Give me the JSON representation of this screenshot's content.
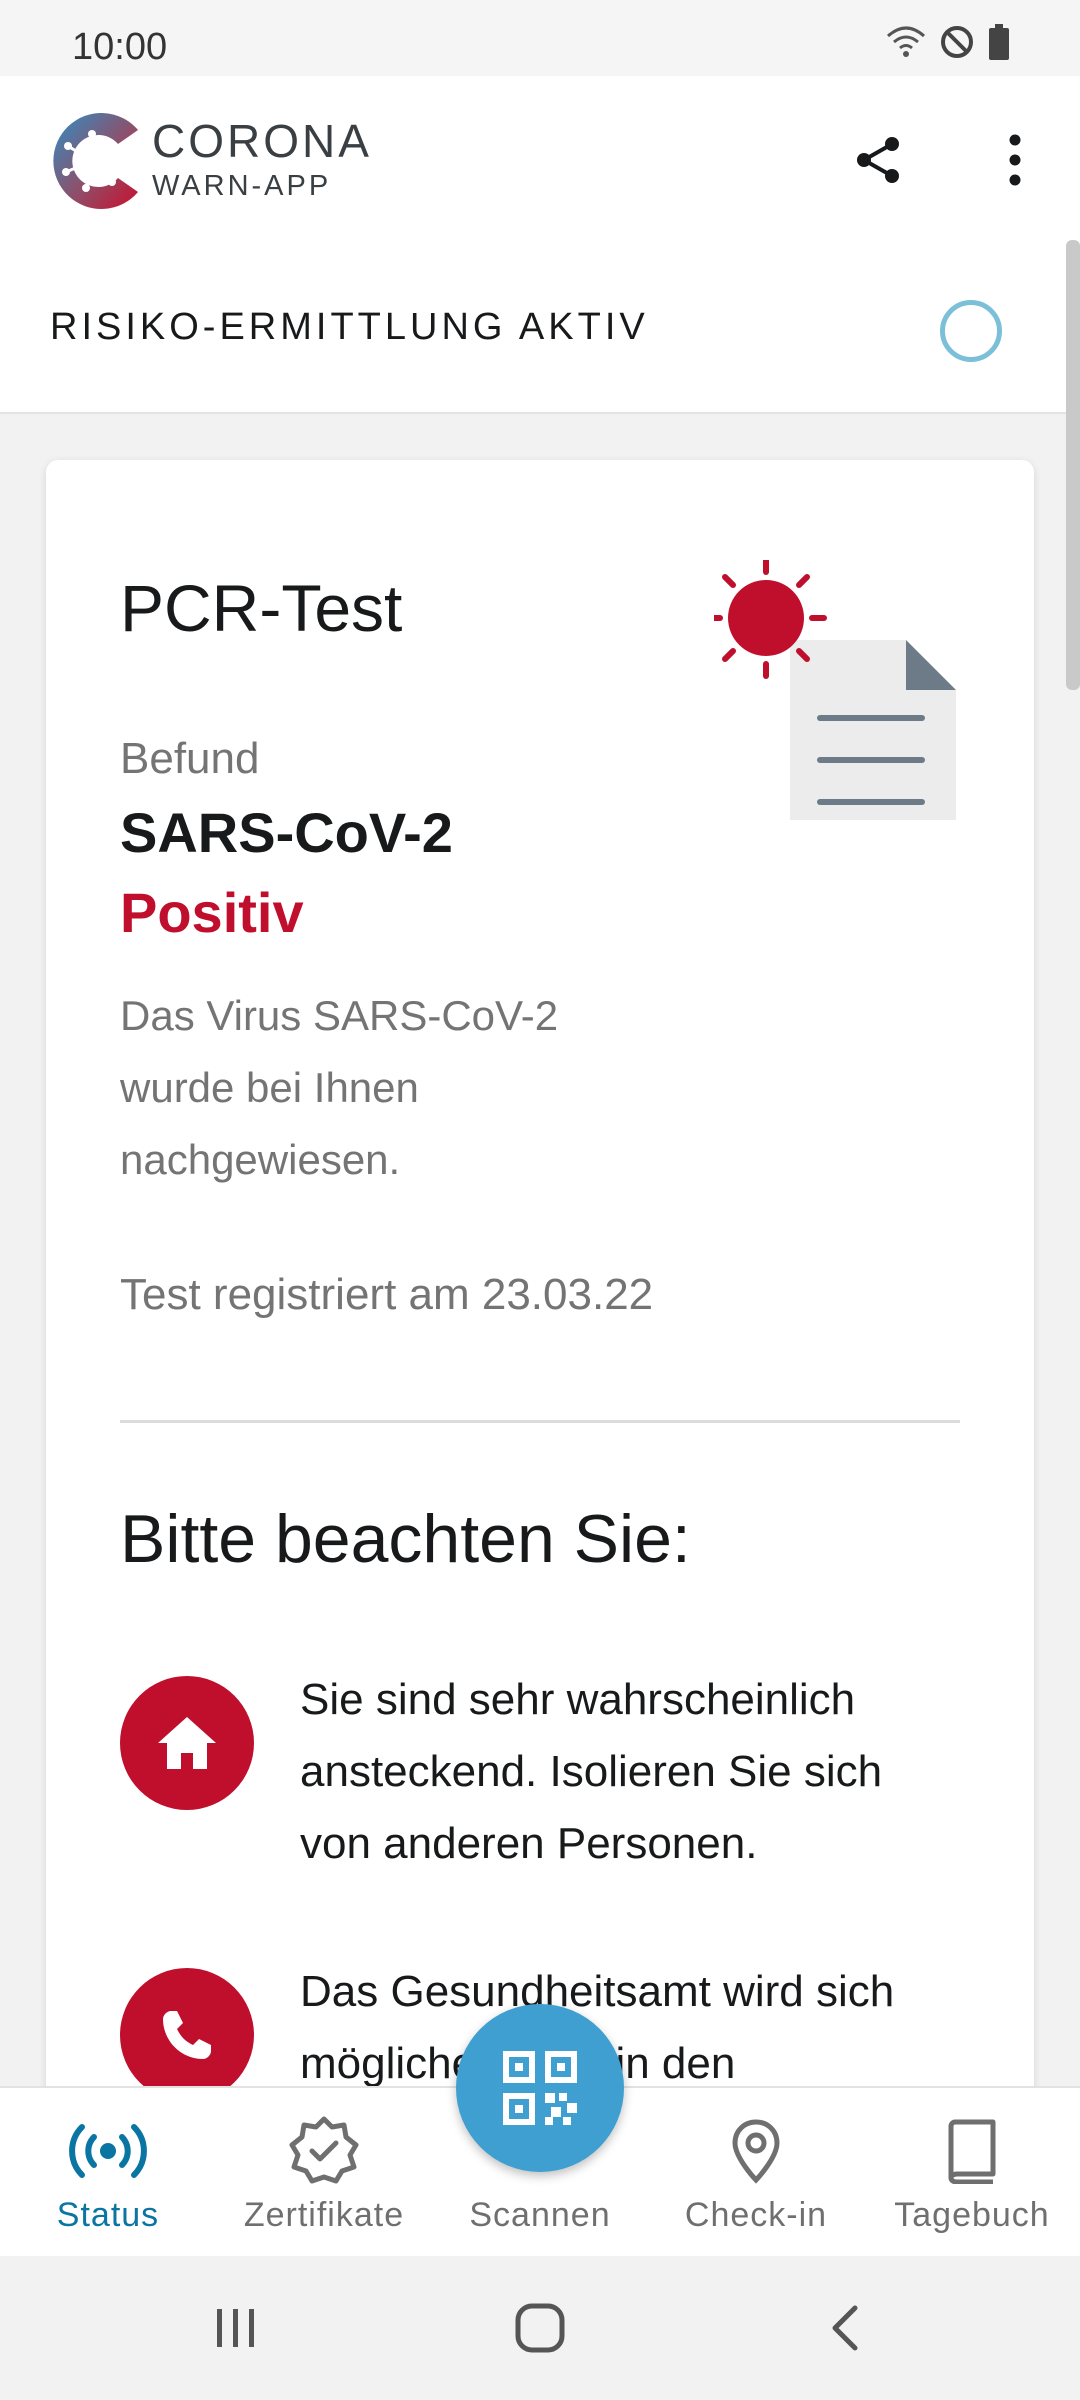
{
  "status_bar": {
    "time": "10:00"
  },
  "app": {
    "brand_line1": "CORONA",
    "brand_line2": "WARN-APP"
  },
  "risk": {
    "label": "RISIKO-ERMITTLUNG AKTIV"
  },
  "card": {
    "title": "PCR-Test",
    "befund_label": "Befund",
    "virus": "SARS-CoV-2",
    "result": "Positiv",
    "description": "Das Virus SARS-CoV-2 wurde bei Ihnen nachgewiesen.",
    "registered": "Test registriert am 23.03.22",
    "notice_title": "Bitte beachten Sie:",
    "items": [
      {
        "icon": "home-icon",
        "text": "Sie sind sehr wahrscheinlich ansteckend. Isolieren Sie sich von anderen Personen."
      },
      {
        "icon": "phone-icon",
        "text": "Das Gesundheitsamt wird sich möglicherweise in den"
      }
    ]
  },
  "nav": {
    "tabs": [
      {
        "label": "Status",
        "icon": "status-icon",
        "active": true
      },
      {
        "label": "Zertifikate",
        "icon": "certificate-icon",
        "active": false
      },
      {
        "label": "Scannen",
        "icon": "qr-scan-icon",
        "active": false
      },
      {
        "label": "Check-in",
        "icon": "location-pin-icon",
        "active": false
      },
      {
        "label": "Tagebuch",
        "icon": "book-icon",
        "active": false
      }
    ]
  },
  "colors": {
    "accent_red": "#c00f2d",
    "accent_blue": "#0a75a3",
    "fab_blue": "#3f9fd0"
  }
}
